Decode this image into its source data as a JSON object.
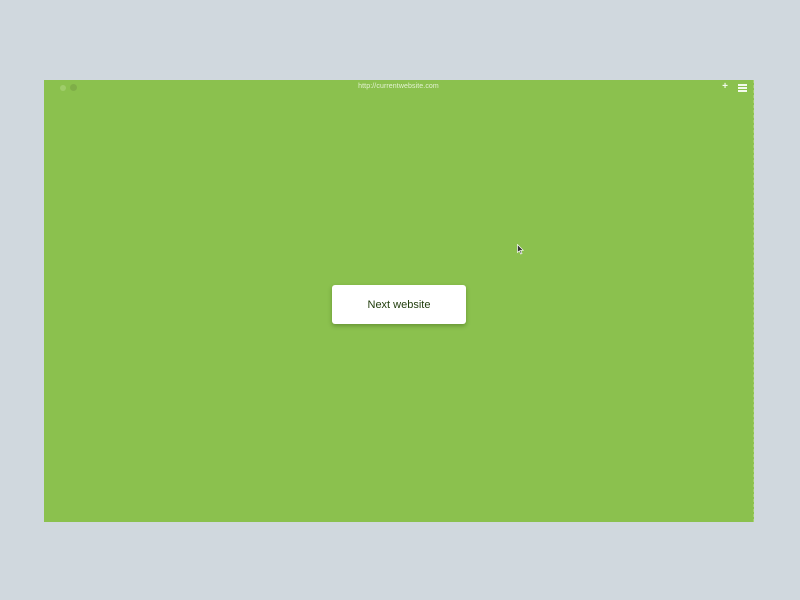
{
  "window": {
    "address": "http://currentwebsite.com"
  },
  "content": {
    "button_label": "Next website"
  },
  "icons": {
    "new_tab": "plus-icon",
    "menu": "hamburger-menu-icon",
    "pointer": "mouse-cursor-icon"
  },
  "colors": {
    "page_background": "#d0d8de",
    "site_background": "#8bc14e",
    "button_background": "#ffffff",
    "button_text": "#1f3b0a"
  }
}
